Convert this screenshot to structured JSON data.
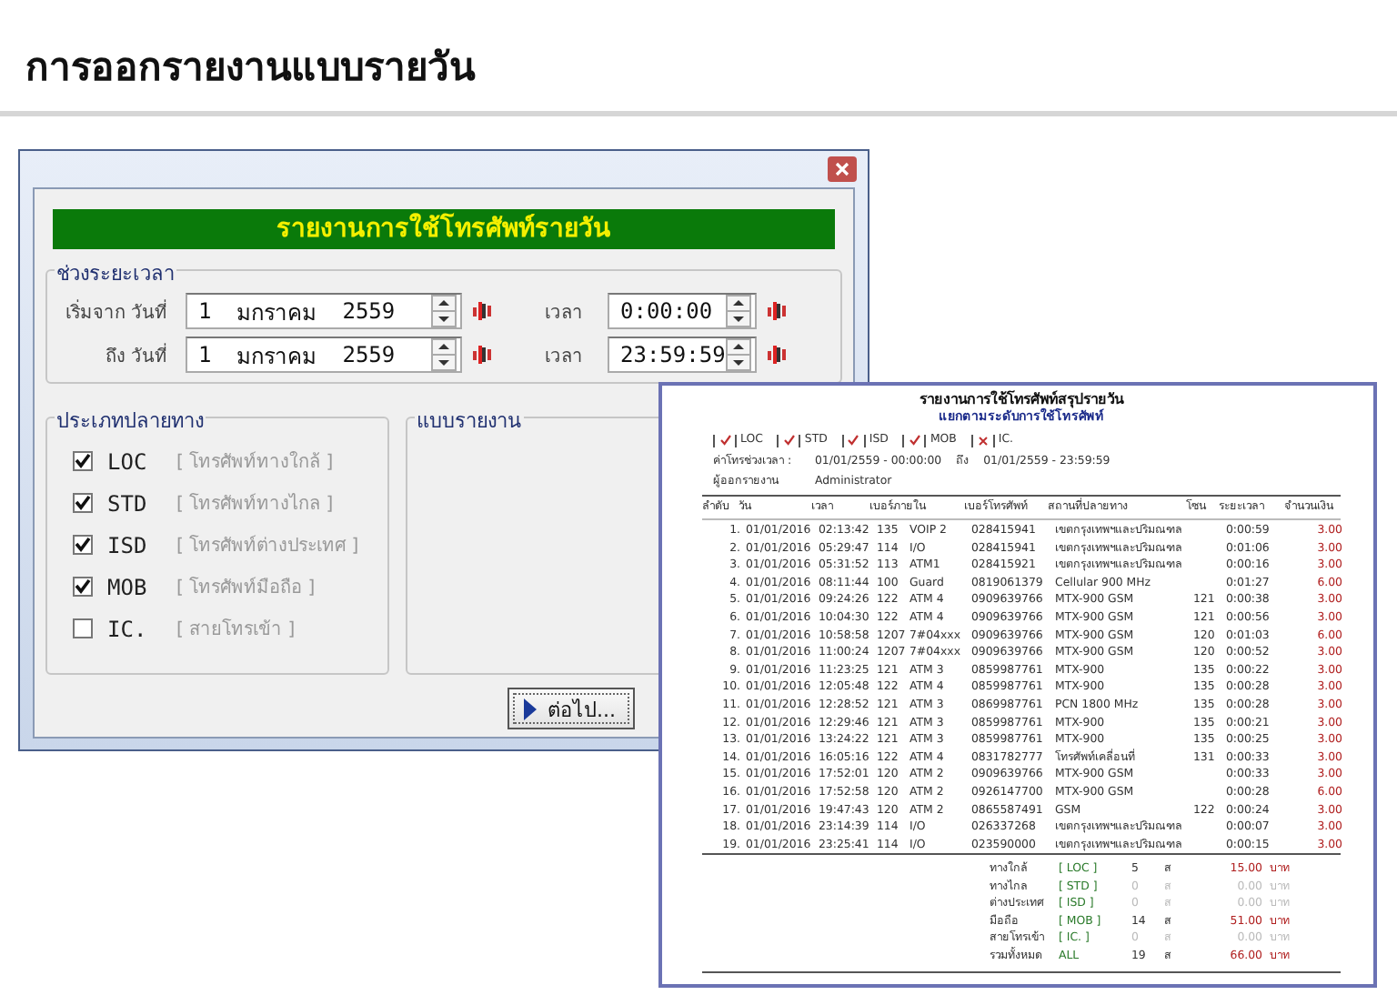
{
  "page_title": "การออกรายงานแบบรายวัน",
  "dialog": {
    "banner": "รายงานการใช้โทรศัพท์รายวัน",
    "period": {
      "title": "ช่วงระยะเวลา",
      "rows": [
        {
          "label": "เริ่มจาก วันที่",
          "day": "1",
          "month": "มกราคม",
          "year": "2559",
          "time_label": "เวลา",
          "time": "0:00:00"
        },
        {
          "label": "ถึง วันที่",
          "day": "1",
          "month": "มกราคม",
          "year": "2559",
          "time_label": "เวลา",
          "time": "23:59:59"
        }
      ]
    },
    "destination": {
      "title": "ประเภทปลายทาง",
      "items": [
        {
          "code": "LOC",
          "description": "[ โทรศัพท์ทางใกล้ ]",
          "checked": true
        },
        {
          "code": "STD",
          "description": "[ โทรศัพท์ทางไกล ]",
          "checked": true
        },
        {
          "code": "ISD",
          "description": "[ โทรศัพท์ต่างประเทศ ]",
          "checked": true
        },
        {
          "code": "MOB",
          "description": "[ โทรศัพท์มือถือ ]",
          "checked": true
        },
        {
          "code": "IC.",
          "description": "[ สายโทรเข้า ]",
          "checked": false
        }
      ]
    },
    "report_type": {
      "title": "แบบรายงาน"
    },
    "next_button": "ต่อไป..."
  },
  "report": {
    "title": "รายงานการใช้โทรศัพท์สรุปรายวัน",
    "subtitle": "แยกตามระดับการใช้โทรศัพท์",
    "filters": [
      {
        "code": "LOC",
        "checked": true
      },
      {
        "code": "STD",
        "checked": true
      },
      {
        "code": "ISD",
        "checked": true
      },
      {
        "code": "MOB",
        "checked": true
      },
      {
        "code": "IC.",
        "checked": false
      }
    ],
    "period_label": "ค่าโทรช่วงเวลา :",
    "period_from": "01/01/2559 - 00:00:00",
    "to_label": "ถึง",
    "period_to": "01/01/2559 - 23:59:59",
    "issuer_label": "ผู้ออกรายงาน",
    "issuer": "Administrator",
    "columns": [
      "ลำดับ",
      "วัน",
      "เวลา",
      "เบอร์ภายใน",
      "",
      "เบอร์โทรศัพท์",
      "สถานที่ปลายทาง",
      "โซน",
      "ระยะเวลา",
      "จำนวนเงิน"
    ],
    "rows": [
      [
        "1.",
        "01/01/2016",
        "02:13:42",
        "135",
        "VOIP 2",
        "028415941",
        "เขตกรุงเทพฯและปริมณฑล",
        "",
        "0:00:59",
        "3.00"
      ],
      [
        "2.",
        "01/01/2016",
        "05:29:47",
        "114",
        "I/O",
        "028415941",
        "เขตกรุงเทพฯและปริมณฑล",
        "",
        "0:01:06",
        "3.00"
      ],
      [
        "3.",
        "01/01/2016",
        "05:31:52",
        "113",
        "ATM1",
        "028415921",
        "เขตกรุงเทพฯและปริมณฑล",
        "",
        "0:00:16",
        "3.00"
      ],
      [
        "4.",
        "01/01/2016",
        "08:11:44",
        "100",
        "Guard",
        "0819061379",
        "Cellular 900 MHz",
        "",
        "0:01:27",
        "6.00"
      ],
      [
        "5.",
        "01/01/2016",
        "09:24:26",
        "122",
        "ATM 4",
        "0909639766",
        "MTX-900 GSM",
        "121",
        "0:00:38",
        "3.00"
      ],
      [
        "6.",
        "01/01/2016",
        "10:04:30",
        "122",
        "ATM 4",
        "0909639766",
        "MTX-900 GSM",
        "121",
        "0:00:56",
        "3.00"
      ],
      [
        "7.",
        "01/01/2016",
        "10:58:58",
        "1207",
        "7#04xxx",
        "0909639766",
        "MTX-900 GSM",
        "120",
        "0:01:03",
        "6.00"
      ],
      [
        "8.",
        "01/01/2016",
        "11:00:24",
        "1207",
        "7#04xxx",
        "0909639766",
        "MTX-900 GSM",
        "120",
        "0:00:52",
        "3.00"
      ],
      [
        "9.",
        "01/01/2016",
        "11:23:25",
        "121",
        "ATM 3",
        "0859987761",
        "MTX-900",
        "135",
        "0:00:22",
        "3.00"
      ],
      [
        "10.",
        "01/01/2016",
        "12:05:48",
        "122",
        "ATM 4",
        "0859987761",
        "MTX-900",
        "135",
        "0:00:28",
        "3.00"
      ],
      [
        "11.",
        "01/01/2016",
        "12:28:52",
        "121",
        "ATM 3",
        "0869987761",
        "PCN 1800 MHz",
        "135",
        "0:00:28",
        "3.00"
      ],
      [
        "12.",
        "01/01/2016",
        "12:29:46",
        "121",
        "ATM 3",
        "0859987761",
        "MTX-900",
        "135",
        "0:00:21",
        "3.00"
      ],
      [
        "13.",
        "01/01/2016",
        "13:24:22",
        "121",
        "ATM 3",
        "0859987761",
        "MTX-900",
        "135",
        "0:00:25",
        "3.00"
      ],
      [
        "14.",
        "01/01/2016",
        "16:05:16",
        "122",
        "ATM 4",
        "0831782777",
        "โทรศัพท์เคลื่อนที่",
        "131",
        "0:00:33",
        "3.00"
      ],
      [
        "15.",
        "01/01/2016",
        "17:52:01",
        "120",
        "ATM 2",
        "0909639766",
        "MTX-900 GSM",
        "",
        "0:00:33",
        "3.00"
      ],
      [
        "16.",
        "01/01/2016",
        "17:52:58",
        "120",
        "ATM 2",
        "0926147700",
        "MTX-900 GSM",
        "",
        "0:00:28",
        "6.00"
      ],
      [
        "17.",
        "01/01/2016",
        "19:47:43",
        "120",
        "ATM 2",
        "0865587491",
        "GSM",
        "122",
        "0:00:24",
        "3.00"
      ],
      [
        "18.",
        "01/01/2016",
        "23:14:39",
        "114",
        "I/O",
        "026337268",
        "เขตกรุงเทพฯและปริมณฑล",
        "",
        "0:00:07",
        "3.00"
      ],
      [
        "19.",
        "01/01/2016",
        "23:25:41",
        "114",
        "I/O",
        "023590000",
        "เขตกรุงเทพฯและปริมณฑล",
        "",
        "0:00:15",
        "3.00"
      ]
    ],
    "summary": [
      {
        "label": "ทางใกล้",
        "code": "[ LOC ]",
        "count": "5",
        "unit": "ส",
        "amount": "15.00",
        "currency": "บาท",
        "empty": false
      },
      {
        "label": "ทางไกล",
        "code": "[ STD ]",
        "count": "0",
        "unit": "ส",
        "amount": "0.00",
        "currency": "บาท",
        "empty": true
      },
      {
        "label": "ต่างประเทศ",
        "code": "[ ISD ]",
        "count": "0",
        "unit": "ส",
        "amount": "0.00",
        "currency": "บาท",
        "empty": true
      },
      {
        "label": "มือถือ",
        "code": "[ MOB ]",
        "count": "14",
        "unit": "ส",
        "amount": "51.00",
        "currency": "บาท",
        "empty": false
      },
      {
        "label": "สายโทรเข้า",
        "code": "[ IC. ]",
        "count": "0",
        "unit": "ส",
        "amount": "0.00",
        "currency": "บาท",
        "empty": true
      },
      {
        "label": "รวมทั้งหมด",
        "code": "ALL",
        "count": "19",
        "unit": "ส",
        "amount": "66.00",
        "currency": "บาท",
        "empty": false
      }
    ]
  }
}
